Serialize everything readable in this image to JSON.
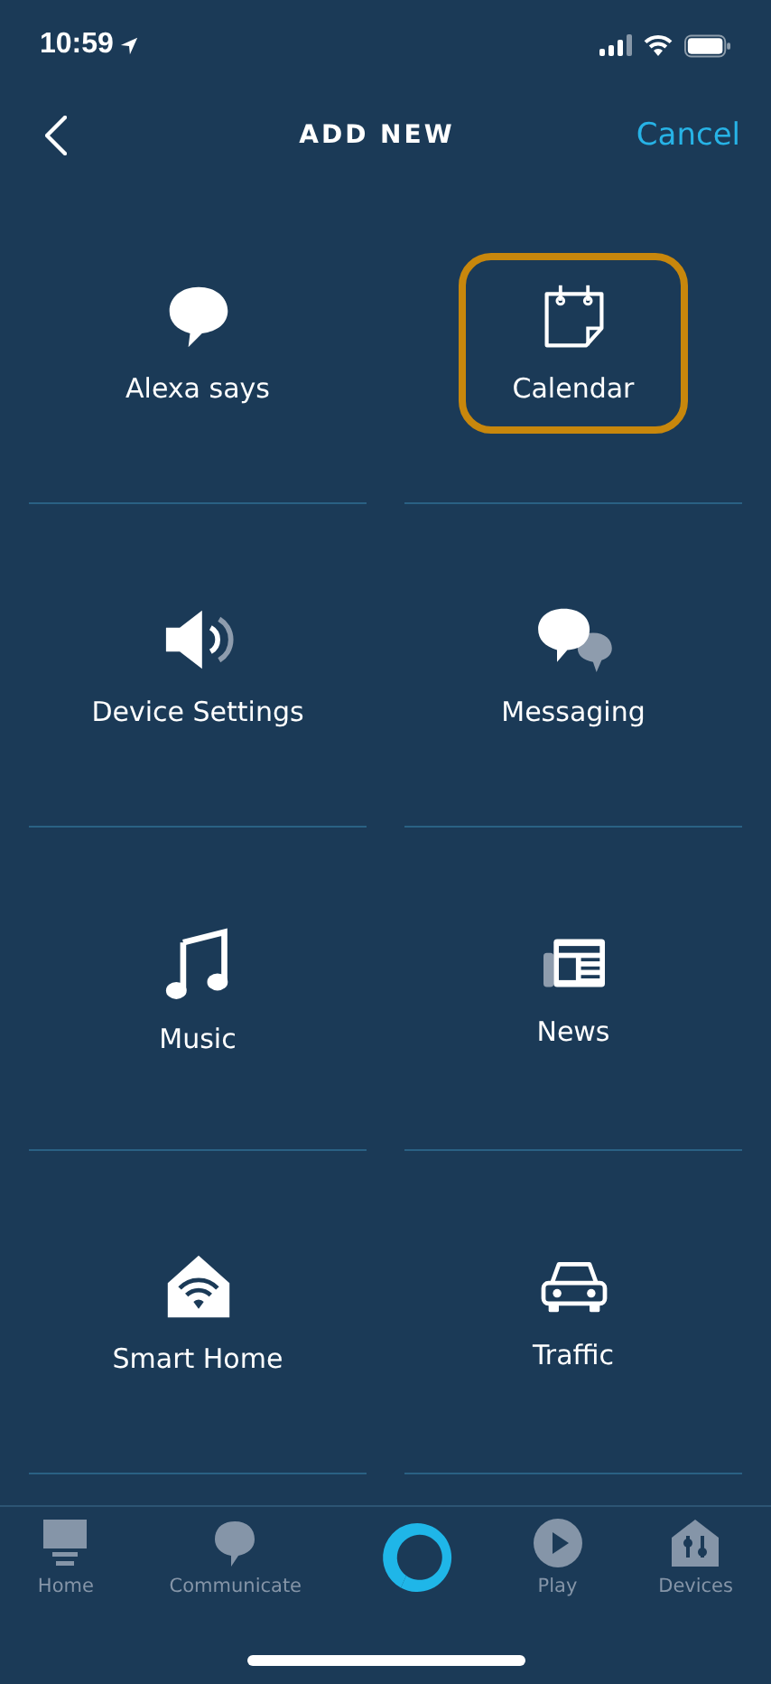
{
  "status_bar": {
    "time": "10:59"
  },
  "nav": {
    "title": "ADD NEW",
    "action": "Cancel"
  },
  "tiles": [
    {
      "label": "Alexa says",
      "kind": "speech",
      "highlighted": false
    },
    {
      "label": "Calendar",
      "kind": "calendar",
      "highlighted": true
    },
    {
      "label": "Device Settings",
      "kind": "speaker",
      "highlighted": false
    },
    {
      "label": "Messaging",
      "kind": "messages",
      "highlighted": false
    },
    {
      "label": "Music",
      "kind": "music",
      "highlighted": false
    },
    {
      "label": "News",
      "kind": "news",
      "highlighted": false
    },
    {
      "label": "Smart Home",
      "kind": "smarthome",
      "highlighted": false
    },
    {
      "label": "Traffic",
      "kind": "car",
      "highlighted": false
    }
  ],
  "tab_bar": [
    {
      "label": "Home",
      "kind": "home"
    },
    {
      "label": "Communicate",
      "kind": "communicate"
    },
    {
      "kind": "alexa"
    },
    {
      "label": "Play",
      "kind": "play"
    },
    {
      "label": "Devices",
      "kind": "devices"
    }
  ]
}
